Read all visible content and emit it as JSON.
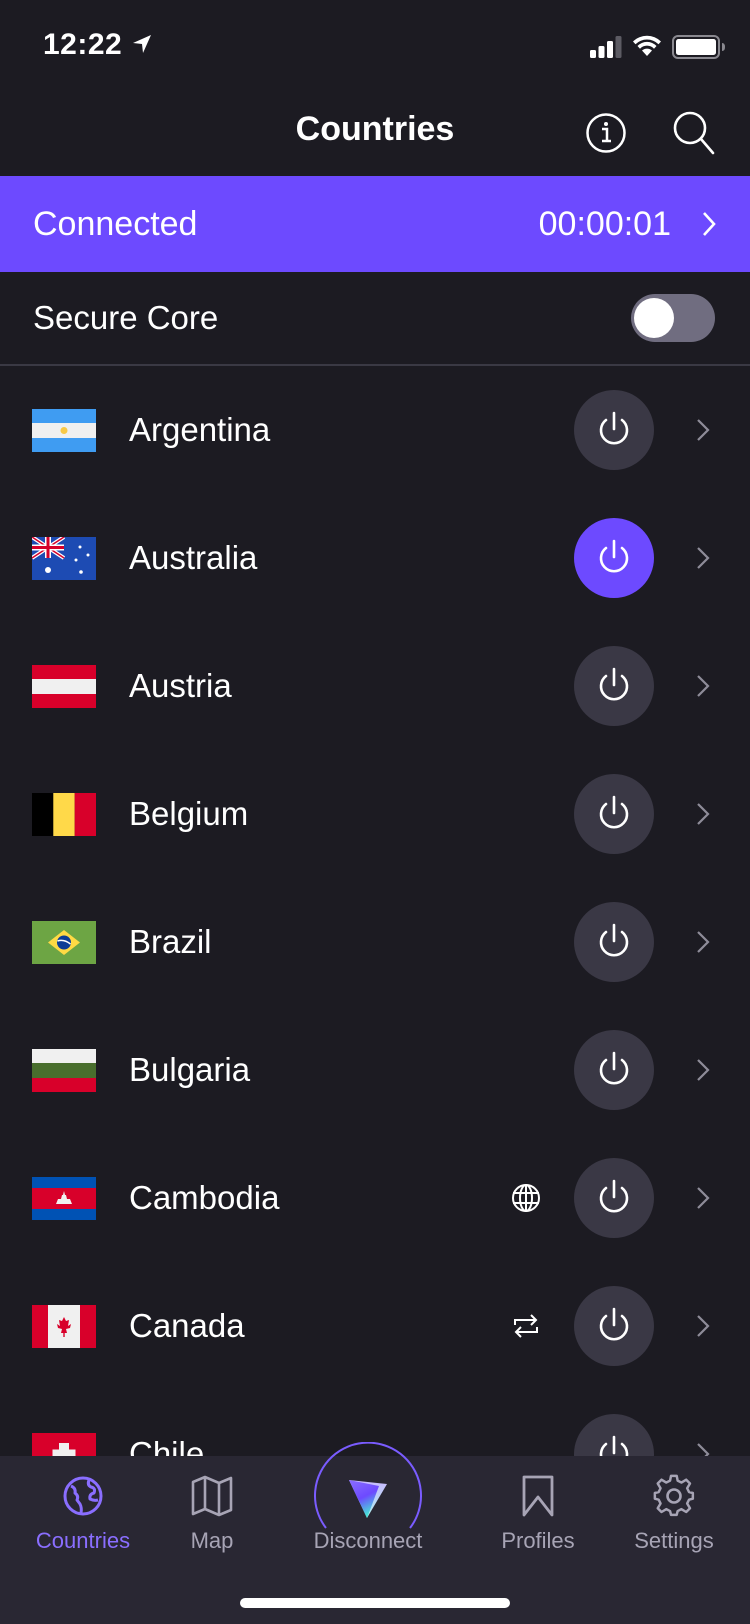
{
  "status_bar": {
    "time": "12:22",
    "location_icon": "location-arrow-icon",
    "signal_bars": 3,
    "signal_max": 4,
    "wifi": "wifi-icon",
    "battery_level": 1.0
  },
  "nav": {
    "title": "Countries",
    "info_icon": "info-icon",
    "search_icon": "search-icon"
  },
  "connection": {
    "status": "Connected",
    "duration": "00:00:01",
    "accent_color": "#6d4aff"
  },
  "secure_core": {
    "label": "Secure Core",
    "enabled": false
  },
  "countries": [
    {
      "name": "Argentina",
      "flag": "argentina",
      "feature": null,
      "connected": false
    },
    {
      "name": "Australia",
      "flag": "australia",
      "feature": null,
      "connected": true
    },
    {
      "name": "Austria",
      "flag": "austria",
      "feature": null,
      "connected": false
    },
    {
      "name": "Belgium",
      "flag": "belgium",
      "feature": null,
      "connected": false
    },
    {
      "name": "Brazil",
      "flag": "brazil",
      "feature": null,
      "connected": false
    },
    {
      "name": "Bulgaria",
      "flag": "bulgaria",
      "feature": null,
      "connected": false
    },
    {
      "name": "Cambodia",
      "flag": "cambodia",
      "feature": "globe-icon",
      "connected": false
    },
    {
      "name": "Canada",
      "flag": "canada",
      "feature": "p2p-arrows-icon",
      "connected": false
    },
    {
      "name": "Chile",
      "flag": "red-white-cross",
      "feature": null,
      "connected": false
    }
  ],
  "tabs": [
    {
      "label": "Countries",
      "icon": "globe-icon",
      "active": true
    },
    {
      "label": "Map",
      "icon": "map-icon",
      "active": false
    },
    {
      "label": "Disconnect",
      "icon": "protonvpn-logo-icon",
      "active": false
    },
    {
      "label": "Profiles",
      "icon": "bookmark-icon",
      "active": false
    },
    {
      "label": "Settings",
      "icon": "gear-icon",
      "active": false
    }
  ]
}
